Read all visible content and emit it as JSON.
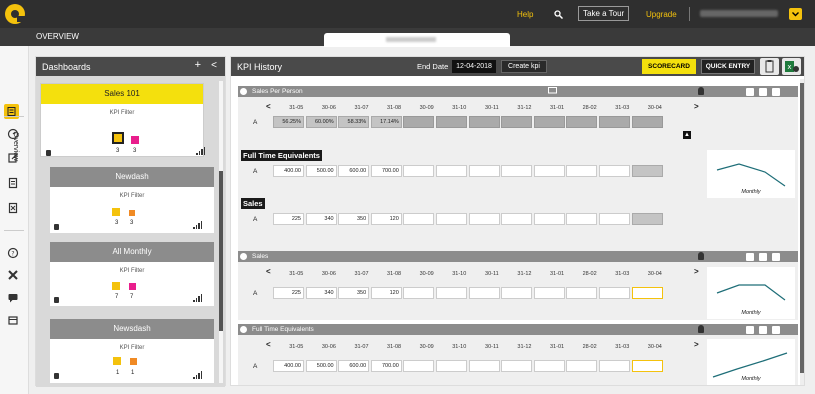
{
  "topbar": {
    "help": "Help",
    "tour": "Take a Tour",
    "upgrade": "Upgrade",
    "icons": [
      "logo-icon",
      "search-icon",
      "chevron-down-icon"
    ]
  },
  "subbar": {
    "title": "OVERVIEW"
  },
  "sidebar": {
    "label": "Overview"
  },
  "dashboards": {
    "title": "Dashboards",
    "add": "+",
    "collapse": "<",
    "cards": [
      {
        "name": "Sales 101",
        "filter": "KPI Filter",
        "c1": "3",
        "c2": "3",
        "color1": "#f4c20d",
        "color2": "#e91e8c"
      },
      {
        "name": "Newdash",
        "filter": "KPI Filter",
        "c1": "3",
        "c2": "3",
        "color1": "#f4c20d",
        "color2": "#f08a24"
      },
      {
        "name": "All Monthly",
        "filter": "KPI Filter",
        "c1": "7",
        "c2": "7",
        "color1": "#f4c20d",
        "color2": "#e91e8c"
      },
      {
        "name": "Newsdash",
        "filter": "KPI Filter",
        "c1": "1",
        "c2": "1",
        "color1": "#f4c20d",
        "color2": "#f08a24"
      }
    ]
  },
  "kpi": {
    "title": "KPI History",
    "end_date_label": "End Date",
    "end_date": "12-04-2018",
    "create": "Create kpi",
    "scorecard": "SCORECARD",
    "quick_entry": "QUICK ENTRY",
    "dates": [
      "31-05",
      "30-06",
      "31-07",
      "31-08",
      "30-09",
      "31-10",
      "30-11",
      "31-12",
      "31-01",
      "28-02",
      "31-03",
      "30-04"
    ],
    "sections": [
      {
        "name": "Sales Per Person",
        "rows": [
          {
            "label": "A",
            "values": [
              "56.25%",
              "60.00%",
              "58.33%",
              "17.14%",
              "",
              "",
              "",
              "",
              "",
              "",
              "",
              ""
            ]
          }
        ],
        "sub": [
          {
            "title": "Full Time Equivalents",
            "label": "A",
            "values": [
              "400.00",
              "500.00",
              "600.00",
              "700.00",
              "",
              "",
              "",
              "",
              "",
              "",
              "",
              ""
            ]
          },
          {
            "title": "Sales",
            "label": "A",
            "values": [
              "225",
              "340",
              "350",
              "120",
              "",
              "",
              "",
              "",
              "",
              "",
              "",
              ""
            ]
          }
        ],
        "mini_label": "Monthly"
      },
      {
        "name": "Sales",
        "rows": [
          {
            "label": "A",
            "values": [
              "225",
              "340",
              "350",
              "120",
              "",
              "",
              "",
              "",
              "",
              "",
              "",
              ""
            ]
          }
        ],
        "mini_label": "Monthly"
      },
      {
        "name": "Full Time Equivalents",
        "rows": [
          {
            "label": "A",
            "values": [
              "400.00",
              "500.00",
              "600.00",
              "700.00",
              "",
              "",
              "",
              "",
              "",
              "",
              "",
              ""
            ]
          }
        ],
        "mini_label": "Monthly"
      }
    ]
  }
}
